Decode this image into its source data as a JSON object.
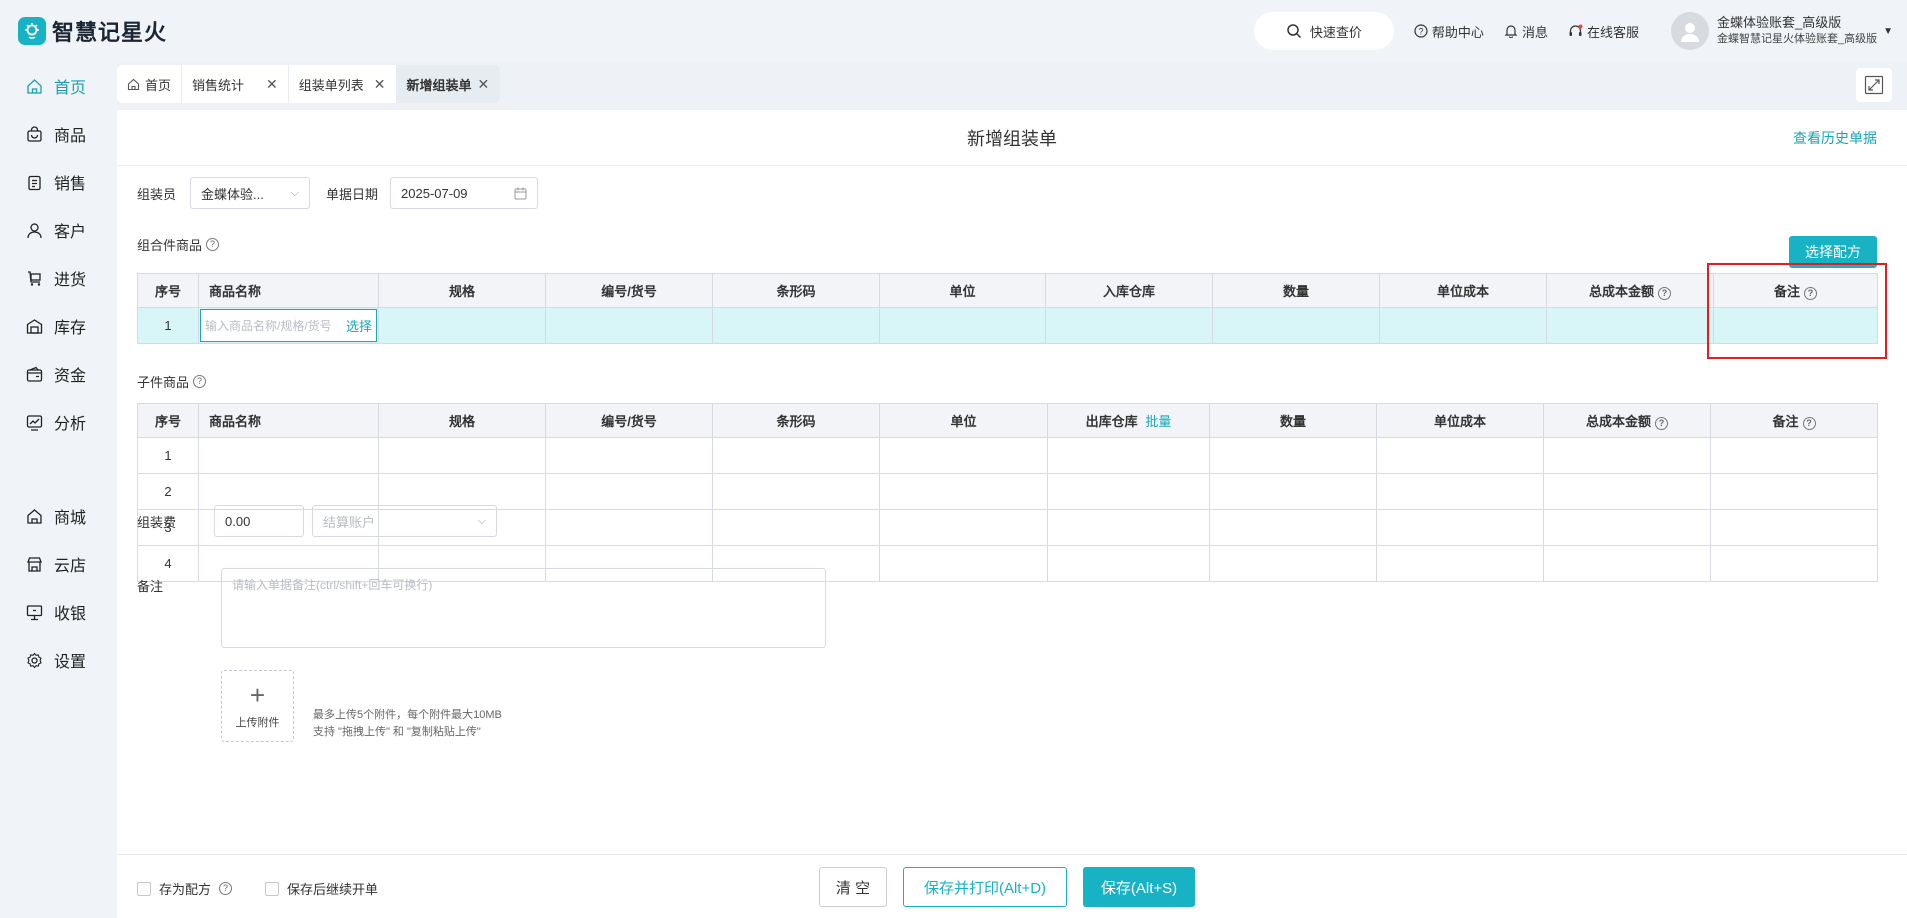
{
  "app": {
    "name": "智慧记星火"
  },
  "topbar": {
    "quick_search": "快速查价",
    "help": "帮助中心",
    "messages": "消息",
    "service": "在线客服",
    "user_name": "金蝶体验账套_高级版",
    "user_sub": "金蝶智慧记星火体验账套_高级版"
  },
  "sidebar": {
    "items": [
      {
        "label": "首页"
      },
      {
        "label": "商品"
      },
      {
        "label": "销售"
      },
      {
        "label": "客户"
      },
      {
        "label": "进货"
      },
      {
        "label": "库存"
      },
      {
        "label": "资金"
      },
      {
        "label": "分析"
      },
      {
        "label": "商城"
      },
      {
        "label": "云店"
      },
      {
        "label": "收银"
      },
      {
        "label": "设置"
      }
    ]
  },
  "tabs": [
    {
      "label": "首页"
    },
    {
      "label": "销售统计"
    },
    {
      "label": "组装单列表"
    },
    {
      "label": "新增组装单"
    }
  ],
  "page": {
    "title": "新增组装单",
    "history_link": "查看历史单据",
    "assembler_label": "组装员",
    "assembler_value": "金蝶体验...",
    "date_label": "单据日期",
    "date_value": "2025-07-09",
    "combo_section": "组合件商品",
    "select_recipe": "选择配方",
    "child_section": "子件商品"
  },
  "combo_table": {
    "headers": [
      "序号",
      "商品名称",
      "规格",
      "编号/货号",
      "条形码",
      "单位",
      "入库仓库",
      "数量",
      "单位成本",
      "总成本金额",
      "备注"
    ],
    "row_index": "1",
    "name_placeholder": "输入商品名称/规格/货号",
    "pick": "选择"
  },
  "child_table": {
    "headers": [
      "序号",
      "商品名称",
      "规格",
      "编号/货号",
      "条形码",
      "单位",
      "出库仓库",
      "数量",
      "单位成本",
      "总成本金额",
      "备注"
    ],
    "batch": "批量",
    "rows": [
      "1",
      "2",
      "3",
      "4"
    ]
  },
  "fee": {
    "label": "组装费",
    "value": "0.00",
    "account_placeholder": "结算账户"
  },
  "remark": {
    "label": "备注",
    "placeholder": "请输入单据备注(ctrl/shift+回车可换行)"
  },
  "upload": {
    "label": "上传附件",
    "note1": "最多上传5个附件，每个附件最大10MB",
    "note2": "支持 \"拖拽上传\" 和 \"复制粘贴上传\""
  },
  "footer": {
    "save_recipe": "存为配方",
    "continue": "保存后继续开单",
    "clear": "清 空",
    "save_print": "保存并打印(Alt+D)",
    "save": "保存(Alt+S)"
  },
  "colors": {
    "accent": "#17b3c4",
    "highlight": "#e02020"
  }
}
